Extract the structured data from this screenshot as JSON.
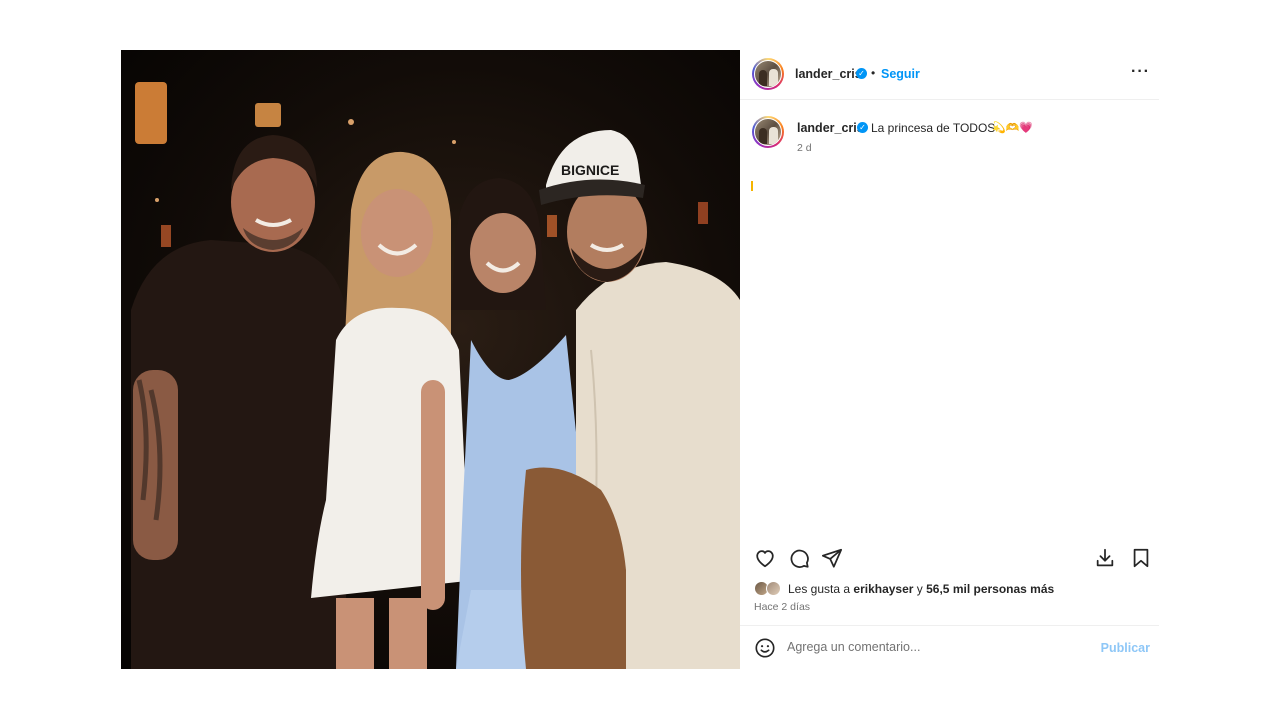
{
  "post": {
    "photo_alt": "",
    "author": {
      "username": "lander_cris",
      "follow_label": "Seguir",
      "separator": "•"
    },
    "caption": {
      "username": "lander_cris",
      "text": "La princesa de TODOS",
      "emojis": "💫🫶💗",
      "age": "2 d"
    },
    "likes": {
      "prefix": "Les gusta a",
      "user": "erikhayser",
      "conjunction": "y",
      "others": "56,5 mil personas más"
    },
    "date": "Hace 2 días",
    "comment": {
      "placeholder": "Agrega un comentario...",
      "value": "",
      "publish_label": "Publicar"
    },
    "icons": {
      "more": "more-options-icon",
      "like": "heart-icon",
      "comment": "comment-icon",
      "share": "share-icon",
      "download": "download-icon",
      "save": "bookmark-icon",
      "emoji": "emoji-icon",
      "verified": "verified-badge-icon"
    },
    "colors": {
      "accent": "#0095f6",
      "publish_disabled": "#8ec7f7",
      "text": "#262626",
      "muted": "#737373"
    }
  }
}
